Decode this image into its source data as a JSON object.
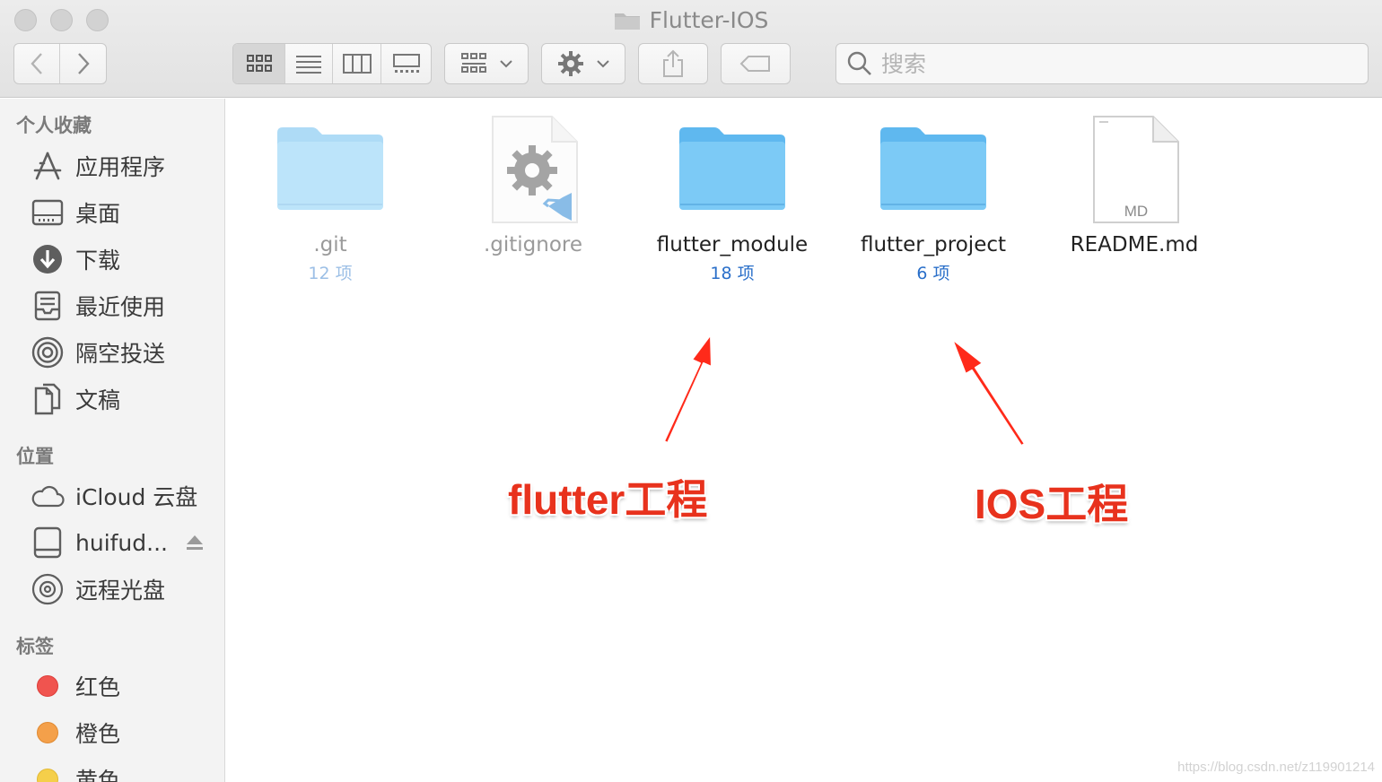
{
  "window": {
    "title": "Flutter-IOS"
  },
  "toolbar": {
    "back_icon": "chevron-left-icon",
    "forward_icon": "chevron-right-icon",
    "view_modes": [
      "icon-view-icon",
      "list-view-icon",
      "column-view-icon",
      "gallery-view-icon"
    ],
    "search_placeholder": "搜索"
  },
  "sidebar": {
    "favorites_title": "个人收藏",
    "favorites": [
      {
        "label": "应用程序",
        "icon": "applications-icon"
      },
      {
        "label": "桌面",
        "icon": "desktop-icon"
      },
      {
        "label": "下载",
        "icon": "downloads-icon"
      },
      {
        "label": "最近使用",
        "icon": "recents-icon"
      },
      {
        "label": "隔空投送",
        "icon": "airdrop-icon"
      },
      {
        "label": "文稿",
        "icon": "documents-icon"
      }
    ],
    "locations_title": "位置",
    "locations": [
      {
        "label": "iCloud 云盘",
        "icon": "icloud-icon"
      },
      {
        "label": "huifud...",
        "icon": "disk-icon"
      },
      {
        "label": "远程光盘",
        "icon": "remote-disc-icon"
      }
    ],
    "tags_title": "标签",
    "tags": [
      {
        "label": "红色",
        "color": "#f0544f"
      },
      {
        "label": "橙色",
        "color": "#f4a04a"
      },
      {
        "label": "黄色",
        "color": "#f5cf4a"
      }
    ]
  },
  "files": [
    {
      "name": ".git",
      "count": "12 项",
      "type": "folder"
    },
    {
      "name": ".gitignore",
      "count": "",
      "type": "vscode-file"
    },
    {
      "name": "flutter_module",
      "count": "18 项",
      "type": "folder"
    },
    {
      "name": "flutter_project",
      "count": "6 项",
      "type": "folder"
    },
    {
      "name": "README.md",
      "count": "",
      "type": "md-file",
      "badge": "MD"
    }
  ],
  "annotations": {
    "left": "flutter工程",
    "right": "IOS工程"
  },
  "watermark": "https://blog.csdn.net/z119901214",
  "colors": {
    "annotation": "#e8321d",
    "folder": "#7ccaf6",
    "count_text": "#2a6fc9"
  }
}
